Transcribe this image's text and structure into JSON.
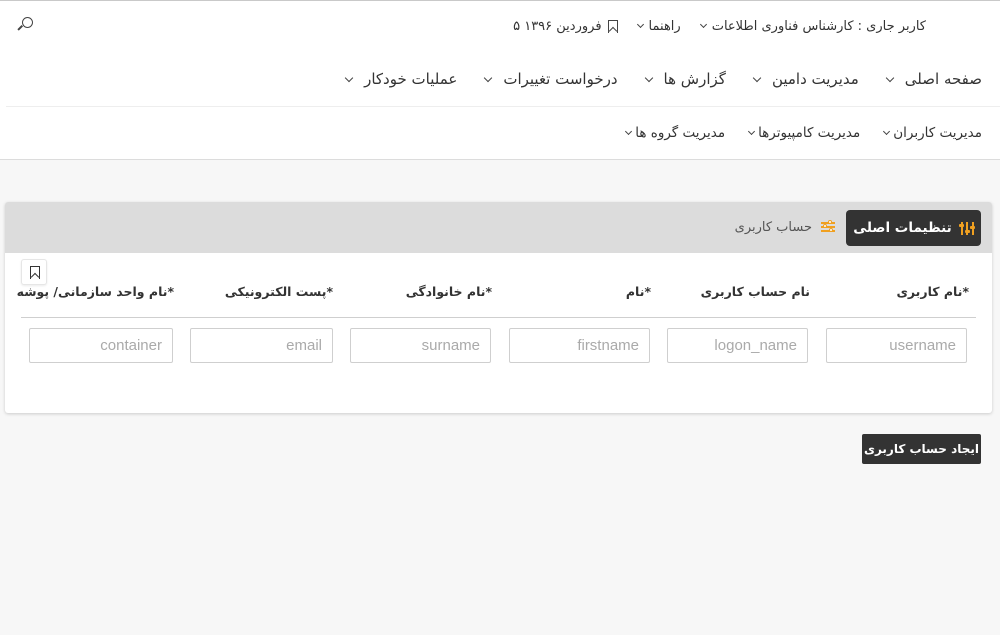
{
  "topbar": {
    "current_user": "کاربر جاری : کارشناس فناوری اطلاعات",
    "help": "راهنما",
    "date": "۵ فروردین ۱۳۹۶"
  },
  "main_nav": [
    "صفحه اصلی",
    "مدیریت دامین",
    "گزارش ها",
    "درخواست تغییرات",
    "عملیات خودکار"
  ],
  "sub_nav": [
    "مدیریت کاربران",
    "مدیریت کامپیوترها",
    "مدیریت گروه ها"
  ],
  "panel": {
    "tab_main": "تنظیمات اصلی",
    "tab_sub": "حساب کاربری",
    "columns": [
      "نام کاربری*",
      "نام حساب کاربری",
      "نام*",
      "نام خانوادگی*",
      "پست الکترونیکی*",
      "نام واحد سازمانی/ پوشه*"
    ],
    "placeholders": [
      "username",
      "logon_name",
      "firstname",
      "surname",
      "email",
      "container"
    ]
  },
  "actions": {
    "create_account": "ایجاد حساب کاربری"
  },
  "colors": {
    "dark": "#333333",
    "accent": "#f0a020",
    "panel_header": "#dcdcdc",
    "page_bg": "#f7f7f7"
  },
  "icons": [
    "search-icon",
    "chevron-down-icon",
    "bookmark-icon",
    "equalizer-icon",
    "sliders-icon"
  ]
}
